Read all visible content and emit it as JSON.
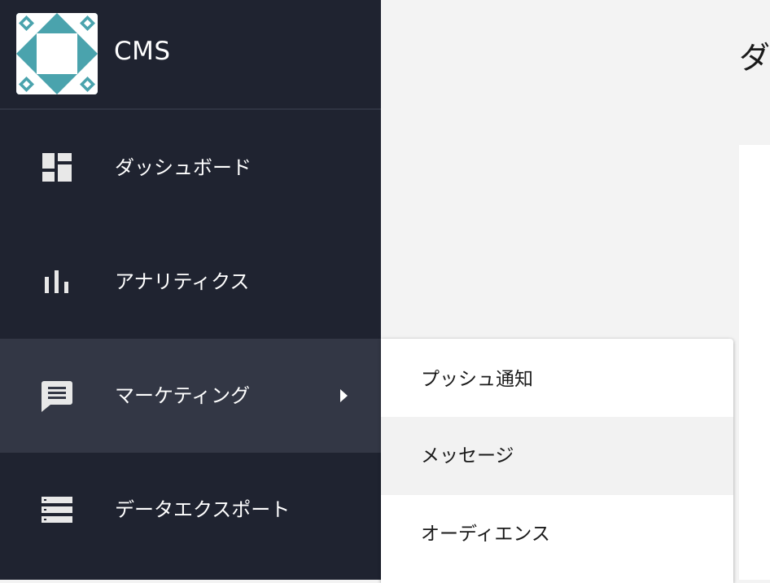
{
  "app": {
    "name": "CMS"
  },
  "main": {
    "heading": "ダ"
  },
  "sidebar": {
    "items": [
      {
        "label": "ダッシュボード",
        "icon": "dashboard-icon"
      },
      {
        "label": "アナリティクス",
        "icon": "bar-chart-icon"
      },
      {
        "label": "マーケティング",
        "icon": "message-icon",
        "active": true,
        "has_submenu": true
      },
      {
        "label": "データエクスポート",
        "icon": "storage-icon"
      }
    ]
  },
  "submenu": {
    "items": [
      {
        "label": "プッシュ通知"
      },
      {
        "label": "メッセージ",
        "hovered": true
      },
      {
        "label": "オーディエンス"
      }
    ]
  },
  "colors": {
    "sidebar_bg": "#1f2330",
    "sidebar_active_bg": "#333745",
    "logo_teal": "#4aa3ad",
    "page_bg": "#f3f3f3",
    "submenu_hover_bg": "#f2f2f2"
  }
}
